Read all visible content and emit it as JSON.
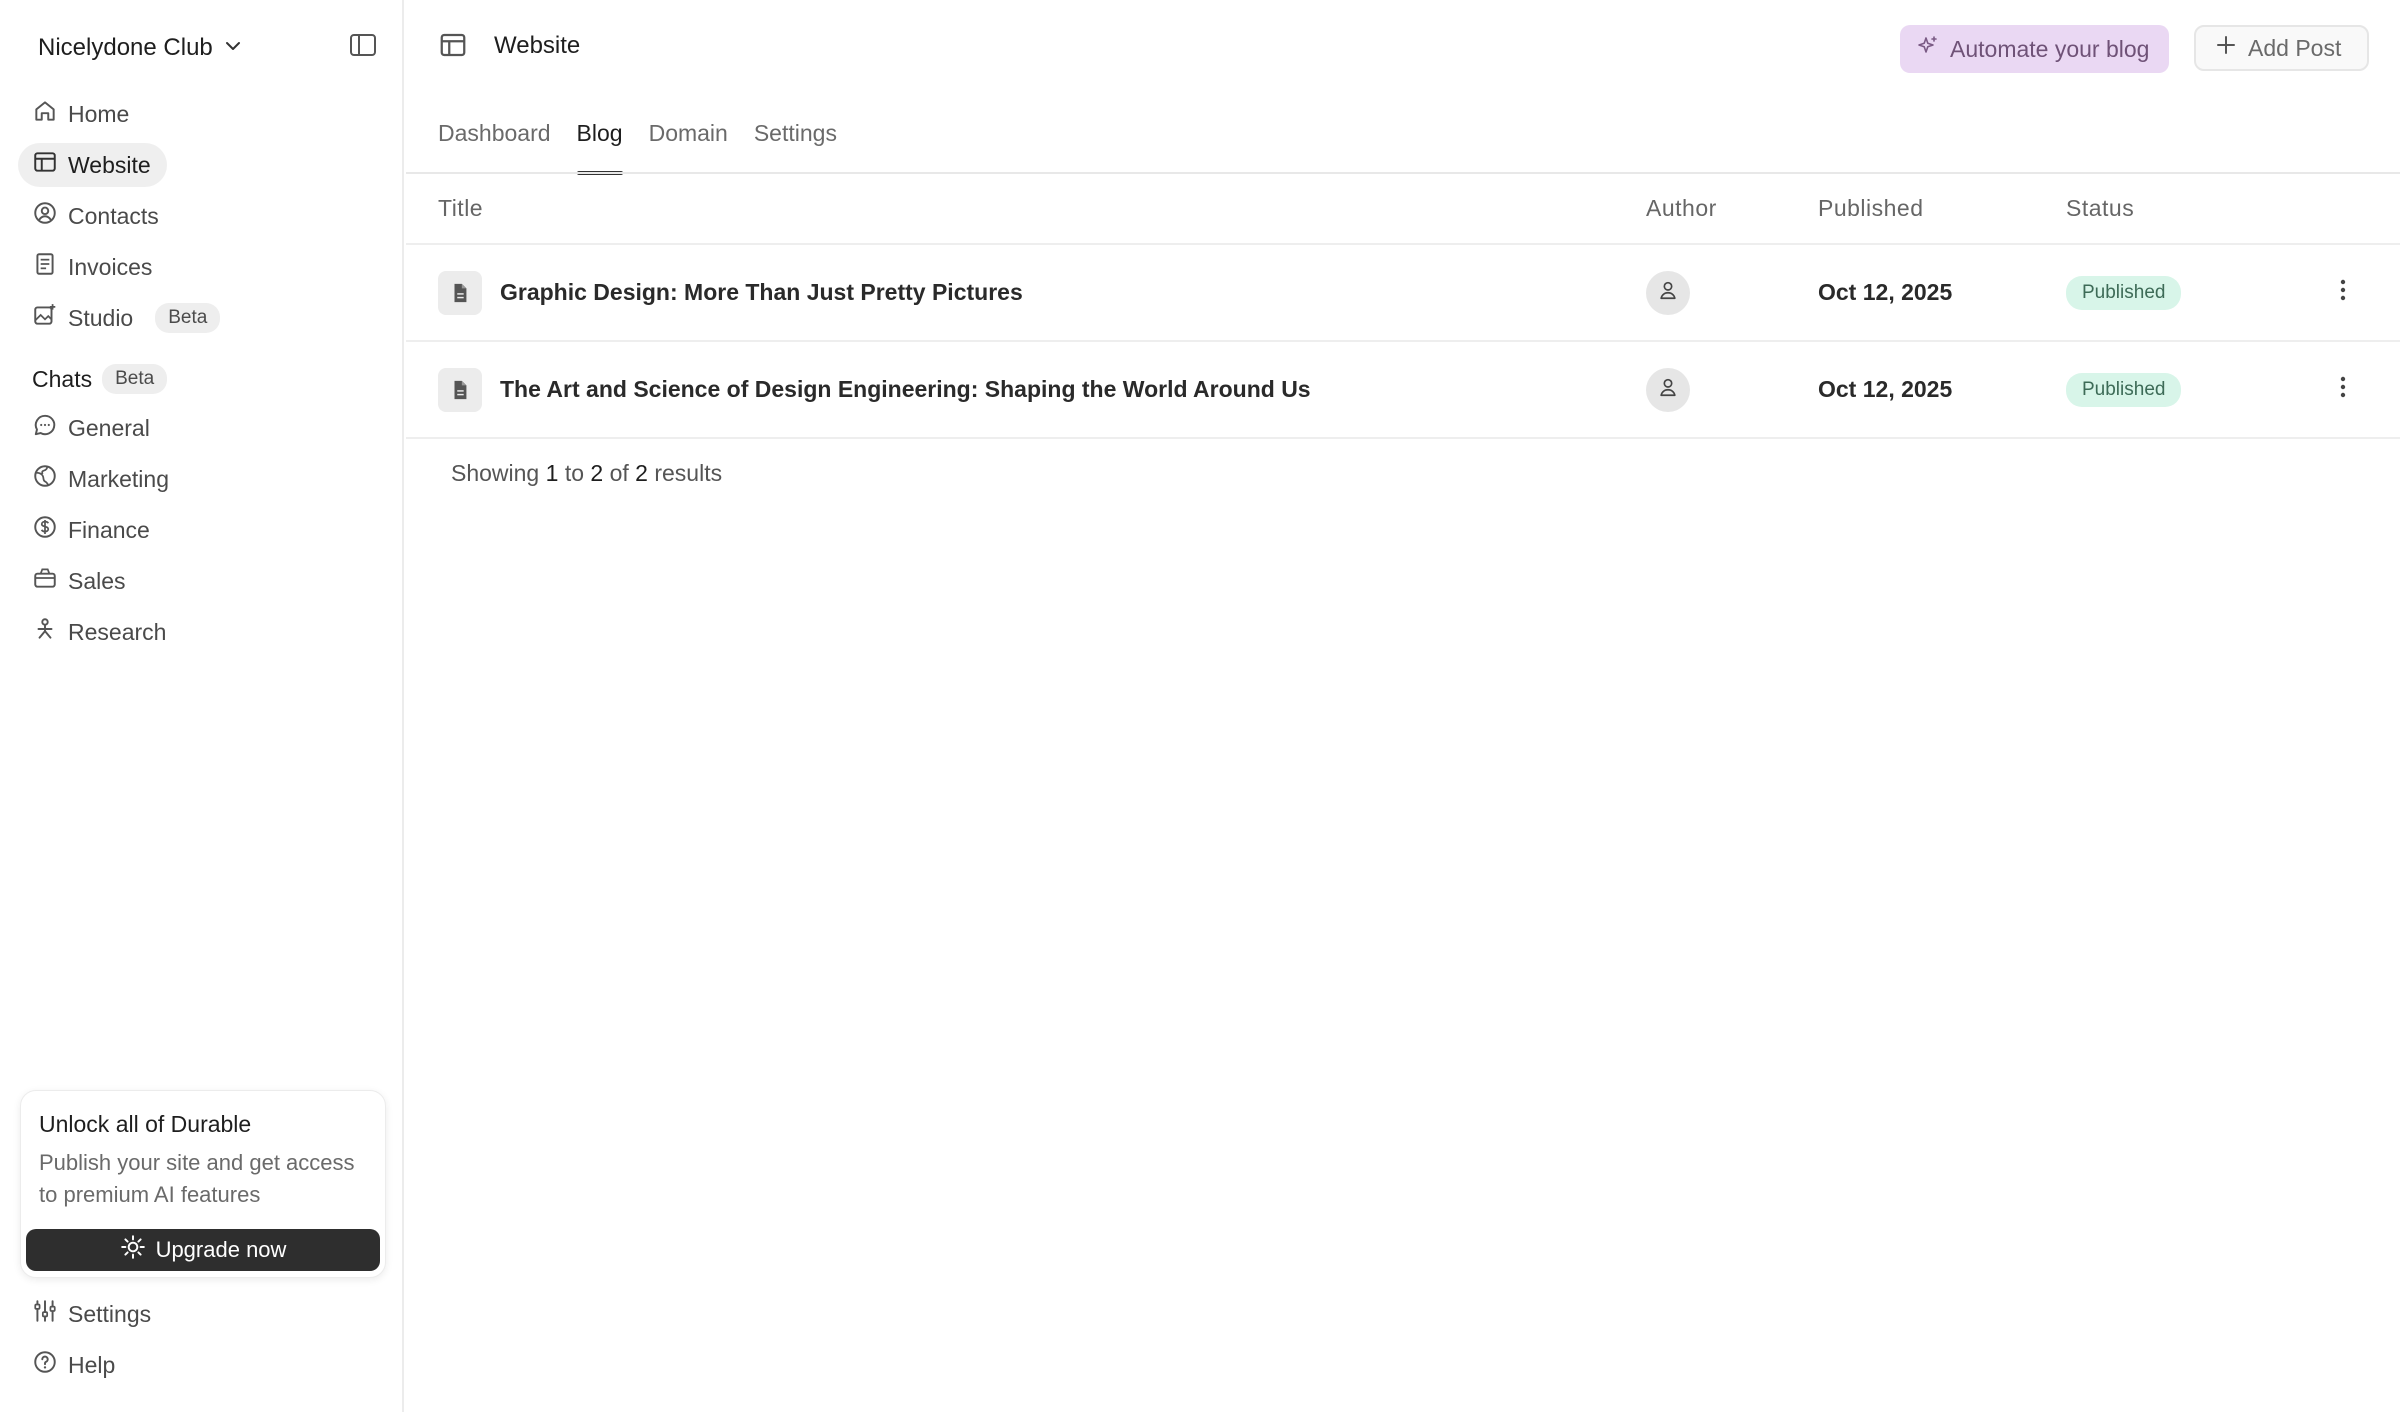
{
  "sidebar": {
    "org_name": "Nicelydone Club",
    "nav": [
      {
        "label": "Home",
        "icon": "home-icon"
      },
      {
        "label": "Website",
        "icon": "layout-icon",
        "active": true
      },
      {
        "label": "Contacts",
        "icon": "user-circle-icon"
      },
      {
        "label": "Invoices",
        "icon": "receipt-icon"
      },
      {
        "label": "Studio",
        "icon": "image-sparkle-icon",
        "badge": "Beta"
      }
    ],
    "chats_title": "Chats",
    "chats_badge": "Beta",
    "chats": [
      {
        "label": "General",
        "icon": "chat-bubble-icon"
      },
      {
        "label": "Marketing",
        "icon": "globe-icon"
      },
      {
        "label": "Finance",
        "icon": "dollar-circle-icon"
      },
      {
        "label": "Sales",
        "icon": "briefcase-icon"
      },
      {
        "label": "Research",
        "icon": "person-network-icon"
      }
    ],
    "upsell": {
      "title": "Unlock all of Durable",
      "description": "Publish your site and get access to premium AI features",
      "button": "Upgrade now"
    },
    "bottom": [
      {
        "label": "Settings",
        "icon": "sliders-icon"
      },
      {
        "label": "Help",
        "icon": "help-circle-icon"
      }
    ]
  },
  "header": {
    "title": "Website",
    "automate_label": "Automate your blog",
    "add_label": "Add Post"
  },
  "tabs": [
    {
      "label": "Dashboard"
    },
    {
      "label": "Blog",
      "active": true
    },
    {
      "label": "Domain"
    },
    {
      "label": "Settings"
    }
  ],
  "table": {
    "columns": [
      "Title",
      "Author",
      "Published",
      "Status"
    ],
    "rows": [
      {
        "title": "Graphic Design: More Than Just Pretty Pictures",
        "published": "Oct 12, 2025",
        "status": "Published"
      },
      {
        "title": "The Art and Science of Design Engineering: Shaping the World Around Us",
        "published": "Oct 12, 2025",
        "status": "Published"
      }
    ]
  },
  "pagination": {
    "prefix": "Showing",
    "from": "1",
    "to_word": "to",
    "to": "2",
    "of_word": "of",
    "total": "2",
    "suffix": "results"
  },
  "colors": {
    "automate_bg": "#ead8f3",
    "status_bg": "#d8f5e9",
    "upgrade_bg": "#2e2e2e",
    "active_nav_bg": "#efefef"
  }
}
